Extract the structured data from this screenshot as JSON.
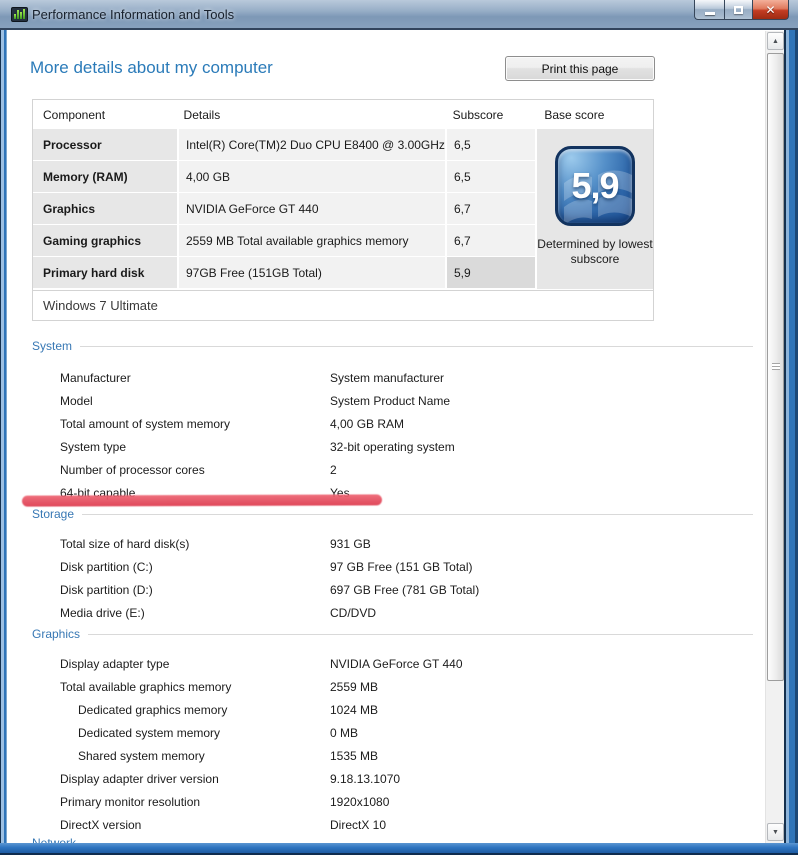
{
  "window": {
    "title": "Performance Information and Tools"
  },
  "page": {
    "heading": "More details about my computer",
    "print_button_label": "Print this page"
  },
  "score_table": {
    "headers": {
      "component": "Component",
      "details": "Details",
      "subscore": "Subscore",
      "base_score": "Base score"
    },
    "rows": [
      {
        "component": "Processor",
        "details": "Intel(R) Core(TM)2 Duo CPU E8400 @ 3.00GHz",
        "subscore": "6,5"
      },
      {
        "component": "Memory (RAM)",
        "details": "4,00 GB",
        "subscore": "6,5"
      },
      {
        "component": "Graphics",
        "details": "NVIDIA GeForce GT 440",
        "subscore": "6,7"
      },
      {
        "component": "Gaming graphics",
        "details": "2559 MB Total available graphics memory",
        "subscore": "6,7"
      },
      {
        "component": "Primary hard disk",
        "details": "97GB Free (151GB Total)",
        "subscore": "5,9"
      }
    ],
    "os_edition": "Windows 7 Ultimate",
    "base_score": {
      "value": "5,9",
      "caption": "Determined by lowest subscore"
    }
  },
  "sections": [
    {
      "title": "System",
      "rows": [
        {
          "label": "Manufacturer",
          "value": "System manufacturer"
        },
        {
          "label": "Model",
          "value": "System Product Name"
        },
        {
          "label": "Total amount of system memory",
          "value": "4,00 GB RAM"
        },
        {
          "label": "System type",
          "value": "32-bit operating system"
        },
        {
          "label": "Number of processor cores",
          "value": "2"
        },
        {
          "label": "64-bit capable",
          "value": "Yes"
        }
      ]
    },
    {
      "title": "Storage",
      "rows": [
        {
          "label": "Total size of hard disk(s)",
          "value": "931 GB"
        },
        {
          "label": "Disk partition (C:)",
          "value": "97 GB Free (151 GB Total)"
        },
        {
          "label": "Disk partition (D:)",
          "value": "697 GB Free (781 GB Total)"
        },
        {
          "label": "Media drive (E:)",
          "value": "CD/DVD"
        }
      ]
    },
    {
      "title": "Graphics",
      "rows": [
        {
          "label": "Display adapter type",
          "value": "NVIDIA GeForce GT 440"
        },
        {
          "label": "Total available graphics memory",
          "value": "2559 MB"
        },
        {
          "label": "Dedicated graphics memory",
          "value": "1024 MB"
        },
        {
          "label": "Dedicated system memory",
          "value": "0 MB"
        },
        {
          "label": "Shared system memory",
          "value": "1535 MB"
        },
        {
          "label": "Display adapter driver version",
          "value": "9.18.13.1070"
        },
        {
          "label": "Primary monitor resolution",
          "value": "1920x1080"
        },
        {
          "label": "DirectX version",
          "value": "DirectX 10"
        }
      ]
    },
    {
      "title": "Network",
      "rows": []
    }
  ],
  "scrollbar": {
    "up_glyph": "▲",
    "down_glyph": "▼"
  },
  "colors": {
    "heading_blue": "#2b7bb9",
    "section_blue": "#3878b4",
    "marker_red": "#dd3a4e",
    "badge_blue": "#2d66a9"
  }
}
